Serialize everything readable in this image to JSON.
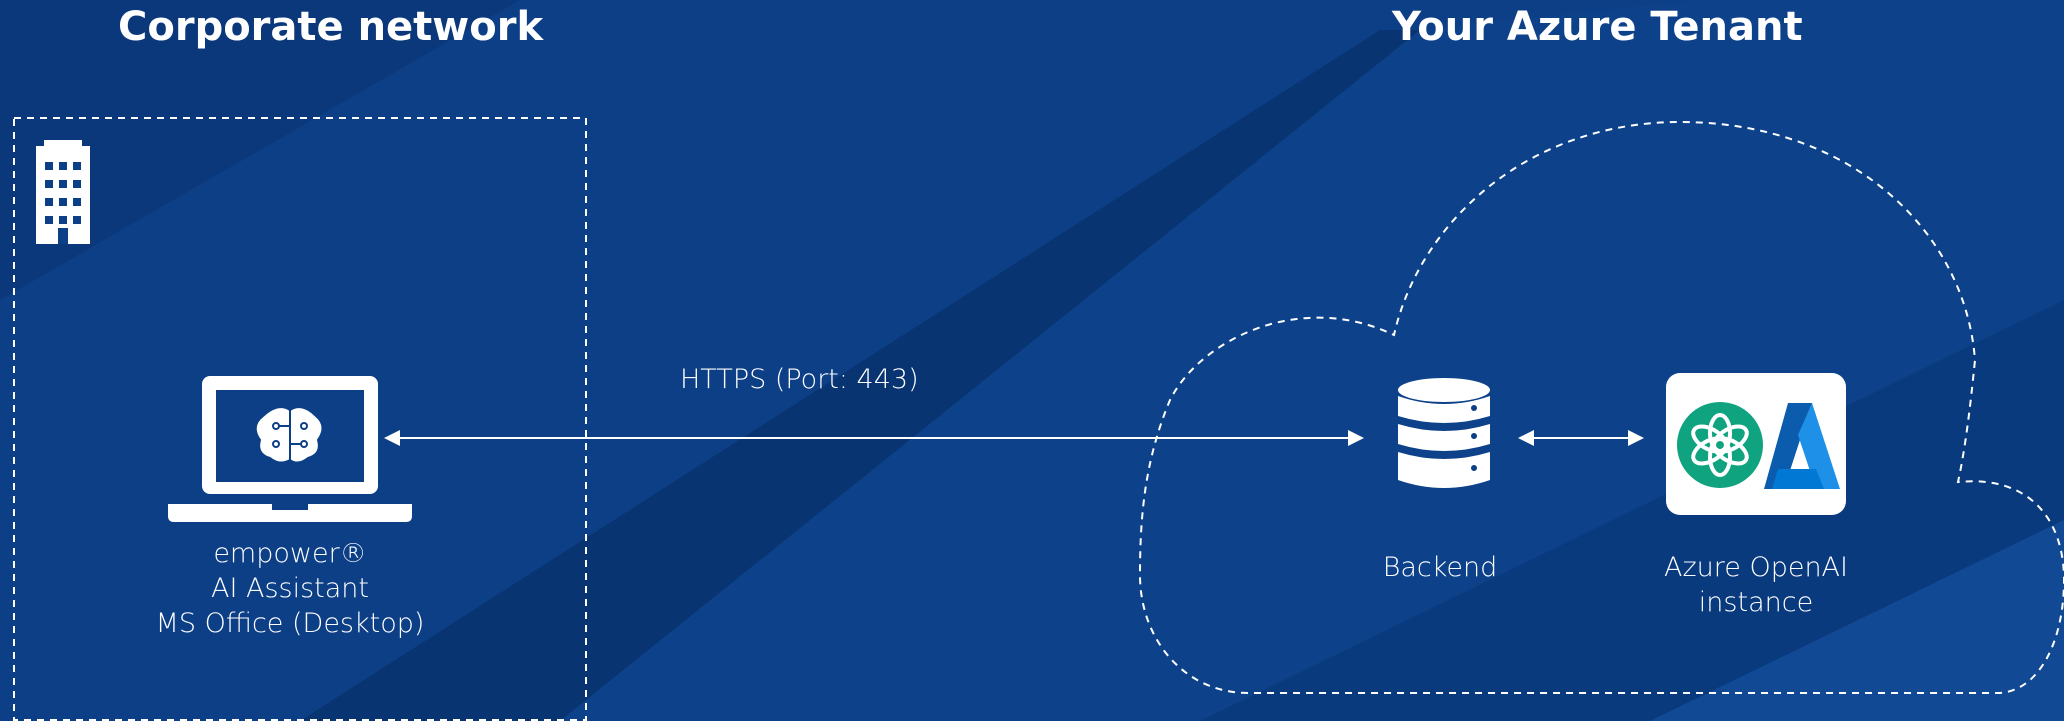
{
  "corporate": {
    "title": "Corporate network",
    "client_label": [
      "empower®",
      "AI Assistant",
      "MS Office (Desktop)"
    ]
  },
  "azure": {
    "title": "Your Azure Tenant",
    "backend_label": "Backend",
    "openai_label": [
      "Azure OpenAI",
      "instance"
    ]
  },
  "connection": {
    "label": "HTTPS (Port: 443)"
  },
  "icons": [
    "building-icon",
    "laptop-icon",
    "brain-circuit-icon",
    "database-icon",
    "openai-icon",
    "azure-icon"
  ],
  "colors": {
    "background": "#0d3f87",
    "stripe_dark": "#08336f",
    "stripe_light": "#14509e",
    "openai_green": "#10a37f",
    "azure_blue": "#0078d4",
    "line": "#ffffff"
  }
}
